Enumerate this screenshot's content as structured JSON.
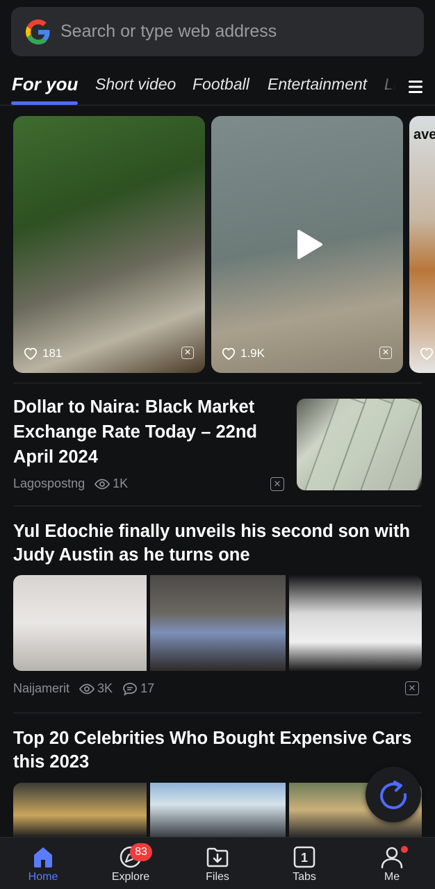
{
  "search": {
    "placeholder": "Search or type web address"
  },
  "tabs": [
    {
      "label": "For you",
      "active": true
    },
    {
      "label": "Short video"
    },
    {
      "label": "Football"
    },
    {
      "label": "Entertainment"
    },
    {
      "label": "Li"
    }
  ],
  "videos": [
    {
      "likes": "181"
    },
    {
      "likes": "1.9K",
      "has_play": true
    },
    {
      "overlay_text": "ave"
    }
  ],
  "articles": [
    {
      "title": "Dollar to Naira: Black Market Exchange Rate Today – 22nd April 2024",
      "source": "Lagospostng",
      "views": "1K"
    },
    {
      "title": "Yul Edochie finally unveils his second son with Judy Austin as he turns one",
      "source": "Naijamerit",
      "views": "3K",
      "comments": "17"
    },
    {
      "title": "Top 20 Celebrities Who Bought Expensive Cars this 2023"
    }
  ],
  "bottom_nav": [
    {
      "label": "Home",
      "active": true
    },
    {
      "label": "Explore",
      "badge": "83"
    },
    {
      "label": "Files"
    },
    {
      "label": "Tabs",
      "count": "1"
    },
    {
      "label": "Me",
      "dot": true
    }
  ],
  "colors": {
    "accent": "#4f6bff",
    "badge": "#f03c3c",
    "background": "#111214"
  }
}
